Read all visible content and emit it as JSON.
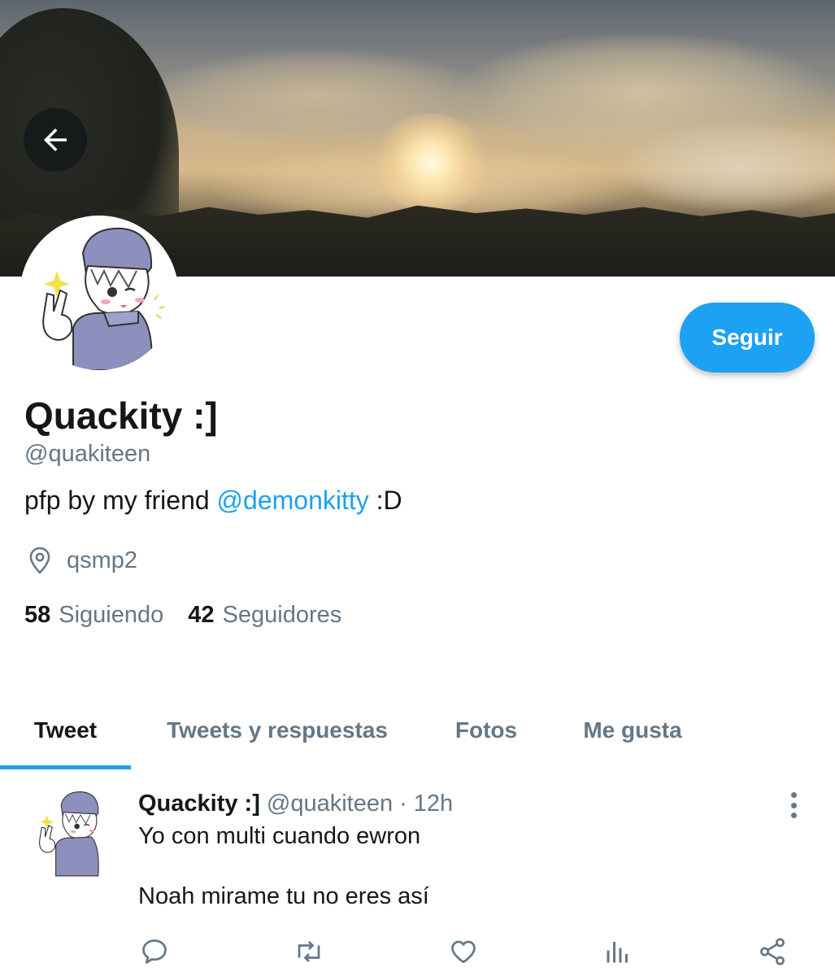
{
  "profile": {
    "name": "Quackity :]",
    "handle": "@quakiteen",
    "bio_prefix": "pfp by my friend ",
    "bio_mention": "@demonkitty",
    "bio_suffix": " :D",
    "location": "qsmp2",
    "following_count": "58",
    "following_label": "Siguiendo",
    "followers_count": "42",
    "followers_label": "Seguidores",
    "follow_button": "Seguir"
  },
  "tabs": [
    {
      "label": "Tweet",
      "active": true
    },
    {
      "label": "Tweets y respuestas",
      "active": false
    },
    {
      "label": "Fotos",
      "active": false
    },
    {
      "label": "Me gusta",
      "active": false
    }
  ],
  "tweet": {
    "name": "Quackity :]",
    "handle": "@quakiteen",
    "separator": "·",
    "time": "12h",
    "line1": "Yo con multi cuando ewron",
    "line2": "Noah mirame tu no eres así"
  },
  "colors": {
    "accent": "#1da1f2",
    "secondary_text": "#657786",
    "primary_text": "#14171a"
  },
  "icons": [
    "back-arrow-icon",
    "location-pin-icon",
    "reply-icon",
    "retweet-icon",
    "like-icon",
    "analytics-icon",
    "share-icon",
    "more-options-icon"
  ]
}
